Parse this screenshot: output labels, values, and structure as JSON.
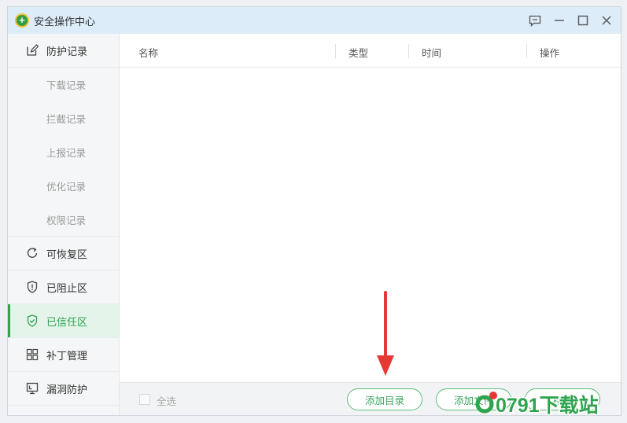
{
  "window": {
    "title": "安全操作中心"
  },
  "sidebar": {
    "items": [
      {
        "label": "防护记录",
        "icon": "edit-icon"
      },
      {
        "label": "下载记录"
      },
      {
        "label": "拦截记录"
      },
      {
        "label": "上报记录"
      },
      {
        "label": "优化记录"
      },
      {
        "label": "权限记录"
      },
      {
        "label": "可恢复区",
        "icon": "restore-icon"
      },
      {
        "label": "已阻止区",
        "icon": "shield-alert-icon"
      },
      {
        "label": "已信任区",
        "icon": "shield-check-icon"
      },
      {
        "label": "补丁管理",
        "icon": "patch-icon"
      },
      {
        "label": "漏洞防护",
        "icon": "monitor-icon"
      }
    ],
    "active": "已信任区"
  },
  "table": {
    "columns": [
      "名称",
      "类型",
      "时间",
      "操作"
    ]
  },
  "footer": {
    "select_all": "全选",
    "add_dir": "添加目录",
    "add_file": "添加文件",
    "remove": "移除"
  },
  "watermark": {
    "text": "0791下载站"
  },
  "colors": {
    "accent": "#2ea44f",
    "titlebar": "#dcecf8",
    "arrow": "#e53935"
  }
}
